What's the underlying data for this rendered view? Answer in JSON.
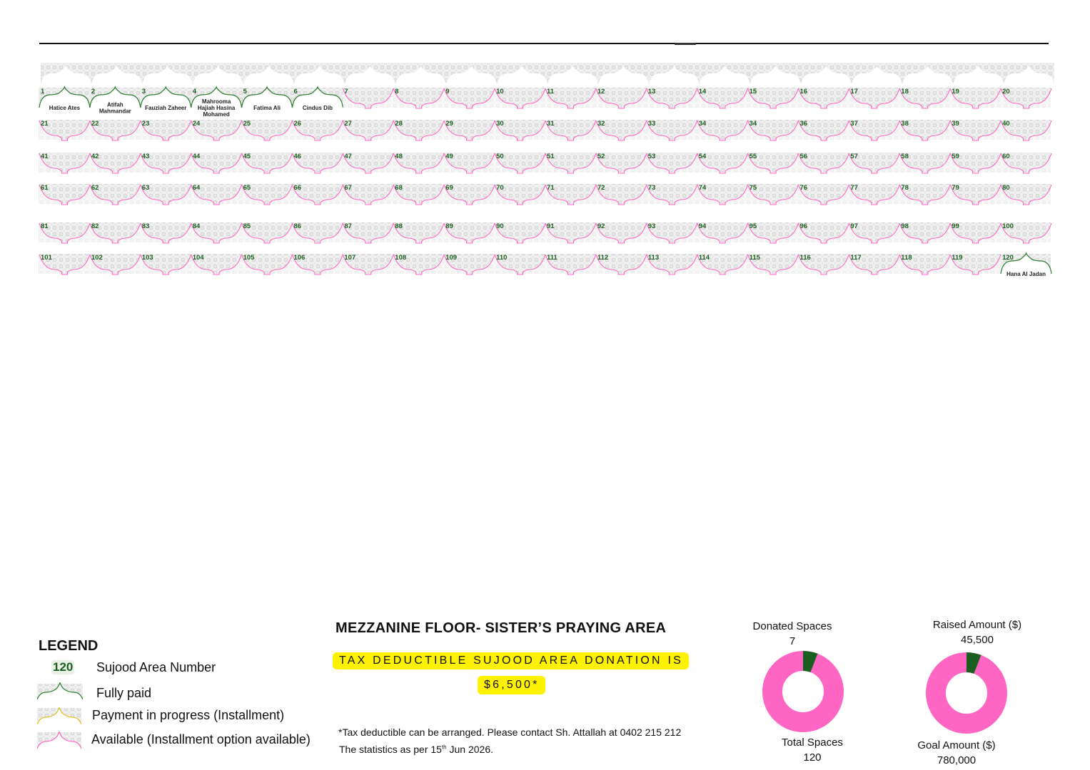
{
  "seat_numbers": [
    "1",
    "2",
    "3",
    "4",
    "5",
    "6",
    "7",
    "8",
    "9",
    "10",
    "11",
    "12",
    "13",
    "14",
    "15",
    "16",
    "17",
    "18",
    "19",
    "20",
    "21",
    "22",
    "23",
    "24",
    "25",
    "26",
    "27",
    "28",
    "29",
    "30",
    "31",
    "32",
    "33",
    "34",
    "34",
    "36",
    "37",
    "38",
    "39",
    "40",
    "41",
    "42",
    "43",
    "44",
    "45",
    "46",
    "47",
    "48",
    "49",
    "50",
    "51",
    "52",
    "53",
    "54",
    "55",
    "56",
    "57",
    "58",
    "59",
    "60",
    "61",
    "62",
    "63",
    "64",
    "65",
    "66",
    "67",
    "68",
    "69",
    "70",
    "71",
    "72",
    "73",
    "74",
    "75",
    "76",
    "77",
    "78",
    "79",
    "80",
    "81",
    "82",
    "83",
    "84",
    "85",
    "86",
    "87",
    "88",
    "89",
    "90",
    "91",
    "92",
    "93",
    "94",
    "95",
    "96",
    "97",
    "98",
    "99",
    "100",
    "101",
    "102",
    "103",
    "104",
    "105",
    "106",
    "107",
    "108",
    "109",
    "110",
    "111",
    "112",
    "113",
    "114",
    "115",
    "116",
    "117",
    "118",
    "119",
    "120"
  ],
  "paid_spaces": [
    {
      "space": 1,
      "donor": [
        "Hatice Ates"
      ]
    },
    {
      "space": 2,
      "donor": [
        "Atifah",
        "Mahmandar"
      ]
    },
    {
      "space": 3,
      "donor": [
        "Fauziah Zaheer"
      ]
    },
    {
      "space": 4,
      "donor": [
        "Mahrooma",
        "Hajiah Hasina",
        "Mohamed"
      ]
    },
    {
      "space": 5,
      "donor": [
        "Fatima Ali"
      ]
    },
    {
      "space": 6,
      "donor": [
        "Cindus Dib"
      ]
    },
    {
      "space": 120,
      "donor": [
        "Hana Al Jadan"
      ]
    }
  ],
  "legend": {
    "title": "LEGEND",
    "sample_number": "120",
    "number_label": "Sujood Area Number",
    "fully_paid": "Fully paid",
    "in_progress": "Payment in progress (Installment)",
    "available": "Available (Installment option available)"
  },
  "title": "MEZZANINE FLOOR- SISTER’S PRAYING AREA",
  "donation_line1": "TAX DEDUCTIBLE SUJOOD AREA DONATION IS",
  "donation_line2": "$6,500*",
  "note1": "*Tax deductible can be arranged. Please contact Sh. Attallah at 0402 215 212",
  "note2_prefix": "The statistics as per 15",
  "note2_sup": "th",
  "note2_suffix": " Jun 2026.",
  "stats": {
    "donated_label": "Donated Spaces",
    "donated_value": 7,
    "total_label": "Total Spaces",
    "total_value": 120,
    "raised_label": "Raised Amount ($)",
    "raised_value": "45,500",
    "raised_number": 45500,
    "goal_label": "Goal Amount ($)",
    "goal_value": "780,000",
    "goal_number": 780000
  },
  "colors": {
    "paid": "#2e7d32",
    "available": "#ff66c4",
    "in_progress": "#e0c020",
    "number": "#1b5e20",
    "donut_paid": "#1b5e20",
    "donut_remaining": "#ff66c4",
    "highlight": "#fff200"
  }
}
